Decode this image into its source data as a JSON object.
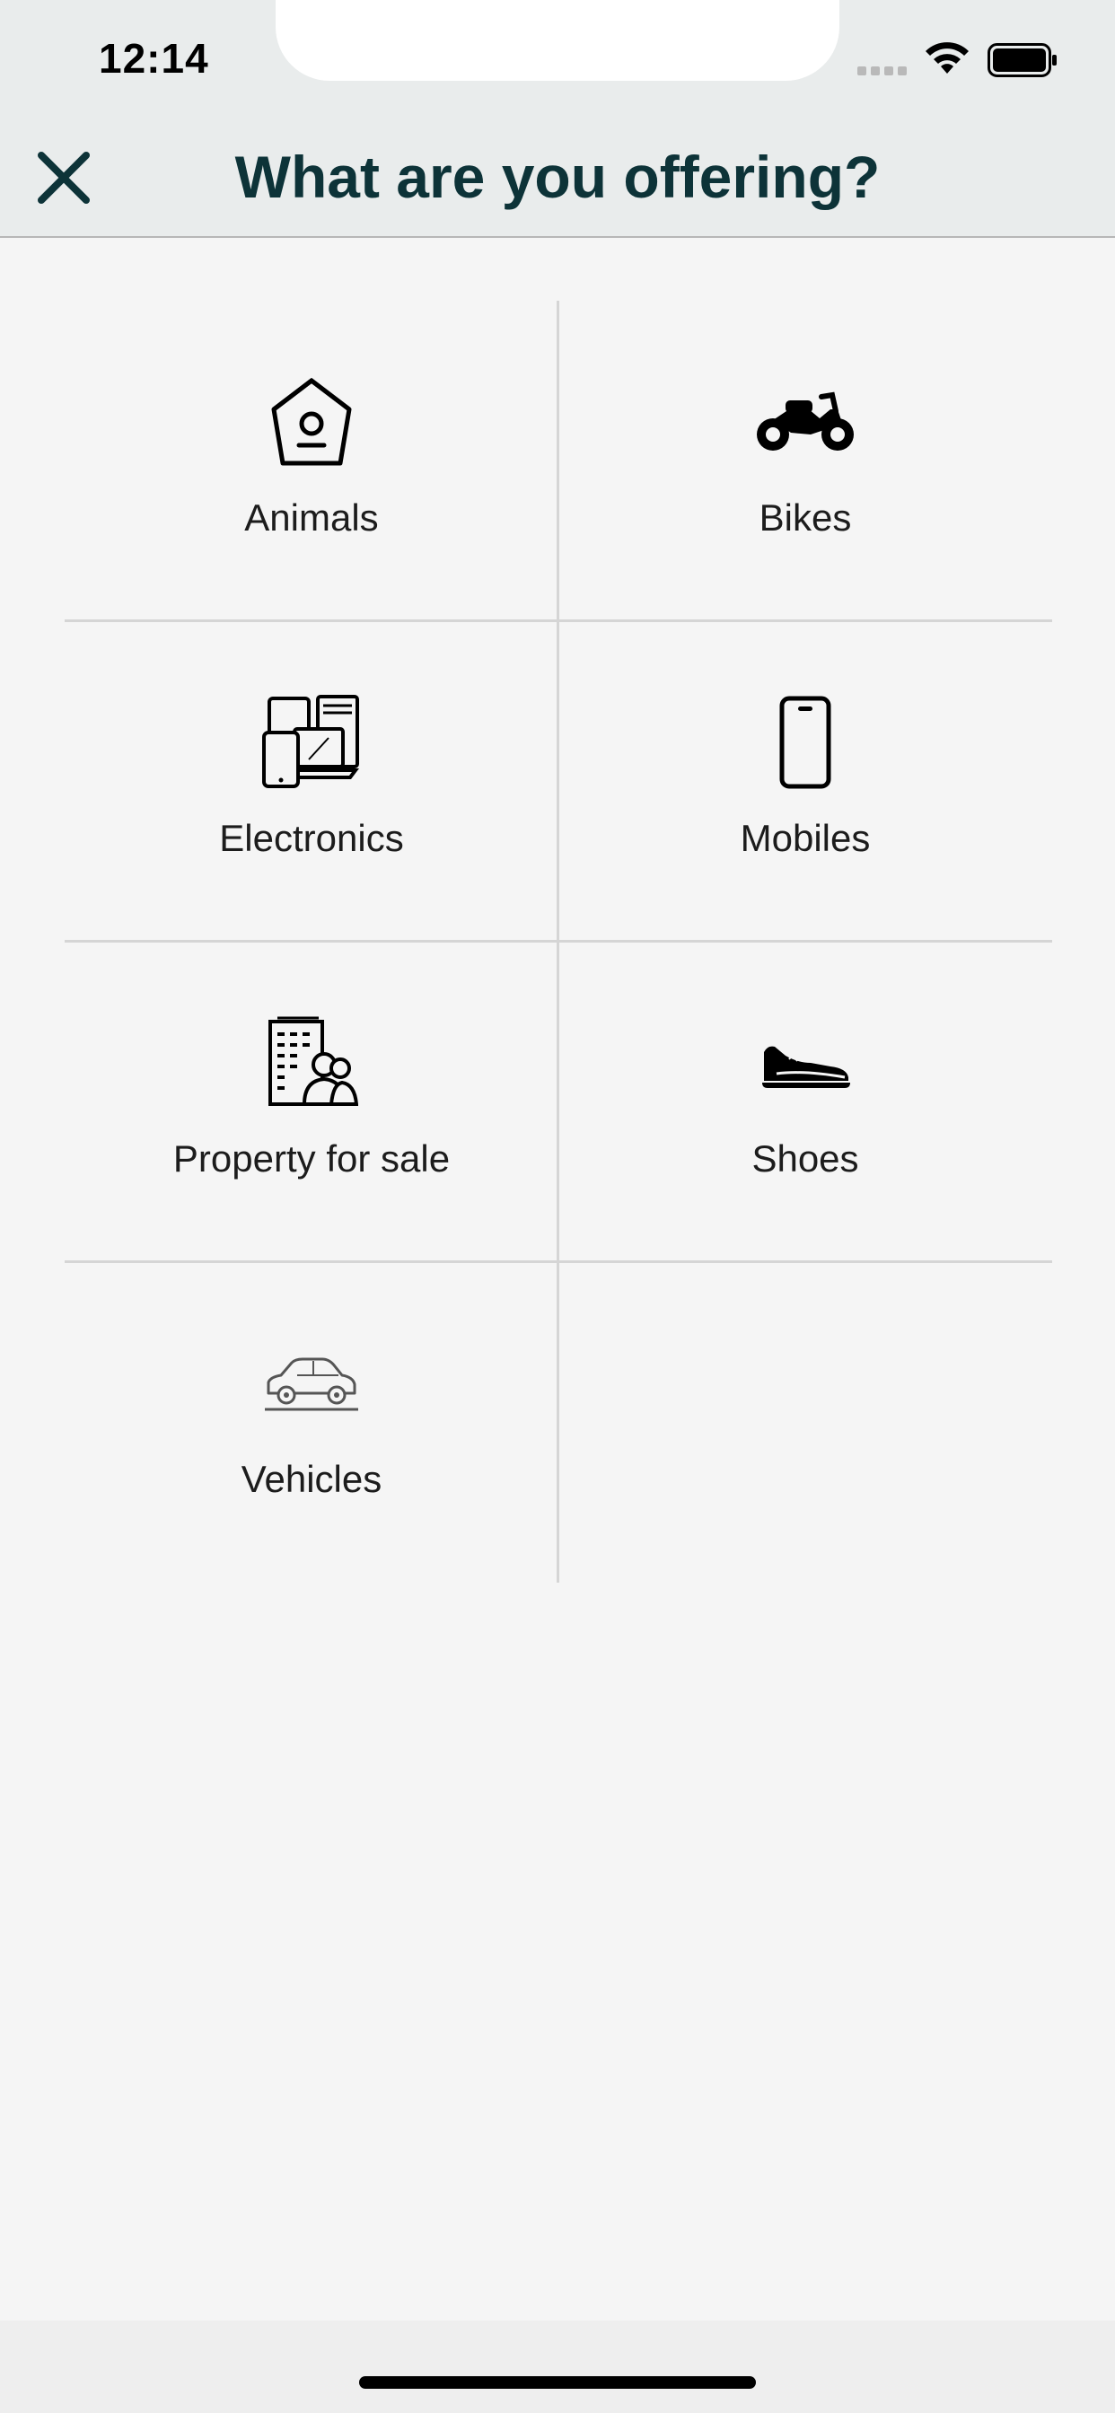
{
  "status_bar": {
    "time": "12:14"
  },
  "header": {
    "title": "What are you offering?",
    "close_icon": "close-icon"
  },
  "categories": [
    {
      "label": "Animals",
      "icon": "birdhouse-icon"
    },
    {
      "label": "Bikes",
      "icon": "motorcycle-icon"
    },
    {
      "label": "Electronics",
      "icon": "devices-icon"
    },
    {
      "label": "Mobiles",
      "icon": "smartphone-icon"
    },
    {
      "label": "Property for sale",
      "icon": "building-people-icon"
    },
    {
      "label": "Shoes",
      "icon": "sneaker-icon"
    },
    {
      "label": "Vehicles",
      "icon": "car-icon"
    }
  ],
  "colors": {
    "title": "#0d3338",
    "header_bg": "#e9ecec",
    "page_bg": "#f5f5f5",
    "divider": "#d5d5d5"
  }
}
